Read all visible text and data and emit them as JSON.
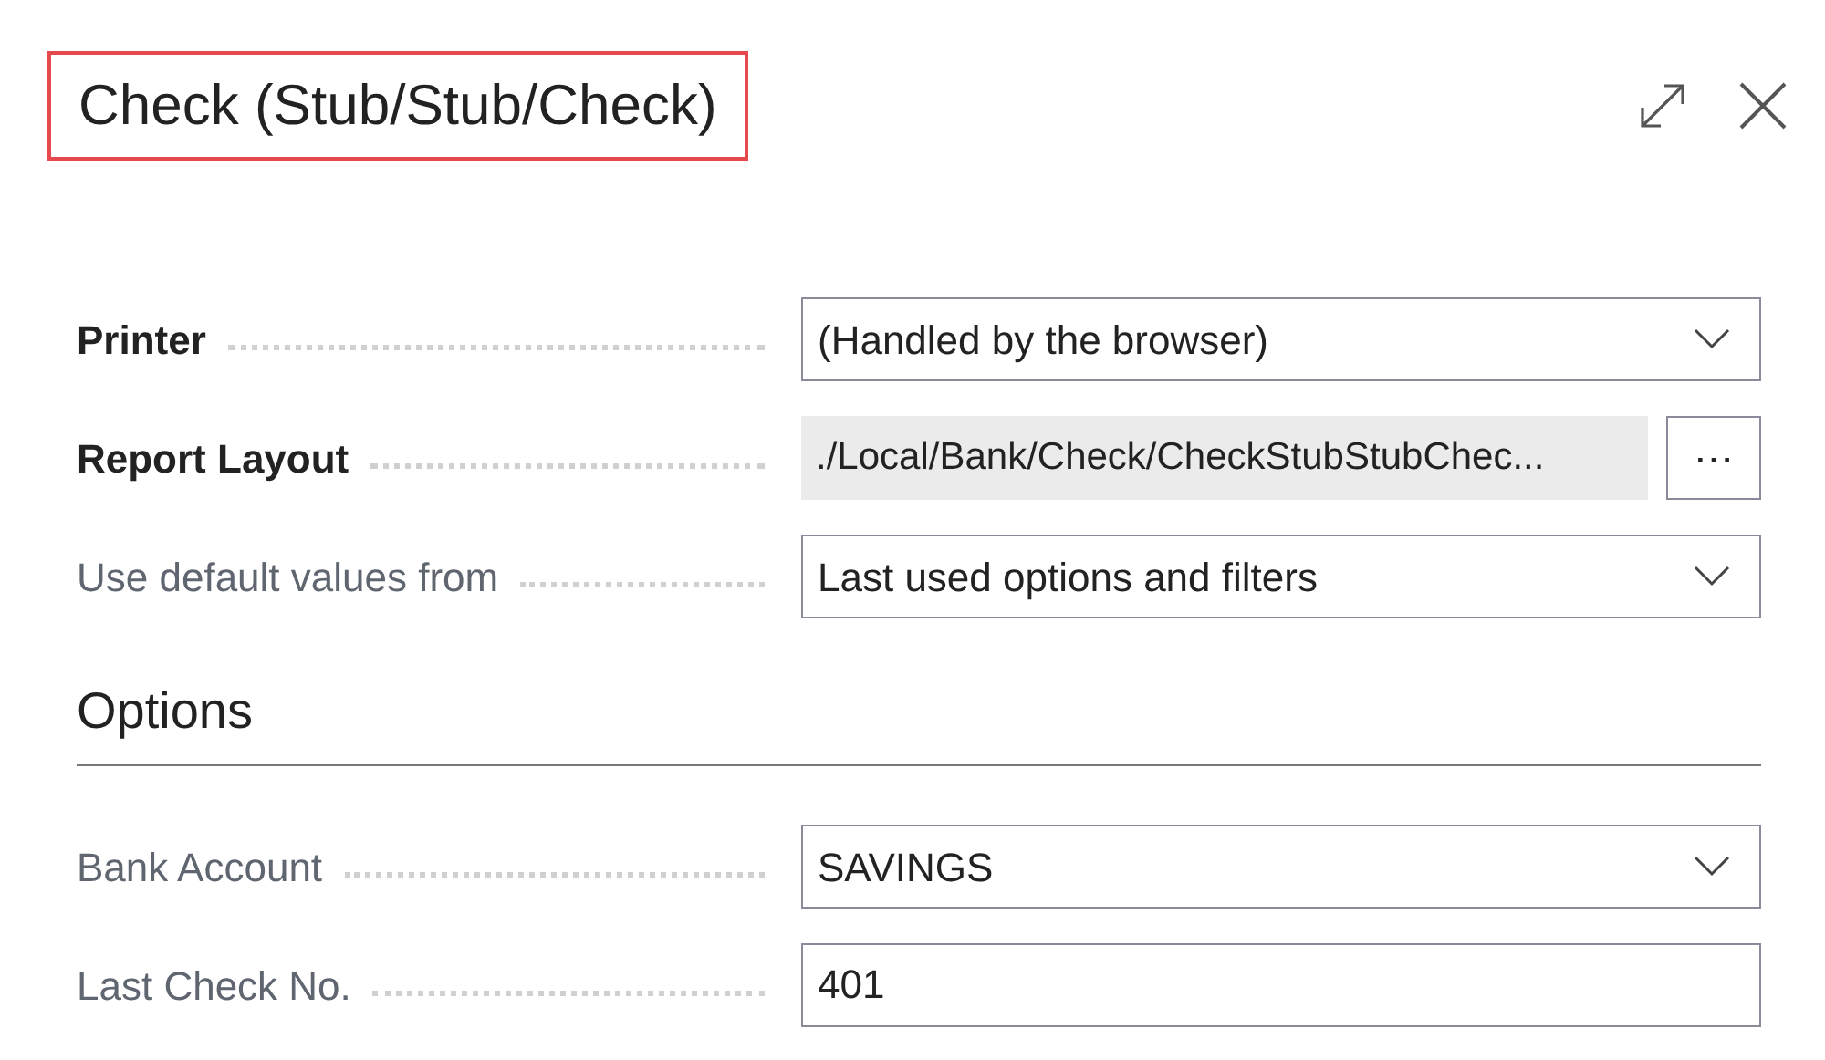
{
  "dialog": {
    "title": "Check (Stub/Stub/Check)",
    "title_highlighted": true
  },
  "fields": [
    {
      "kind": "dropdown",
      "label": "Printer",
      "emphasized": true,
      "value": "(Handled by the browser)"
    },
    {
      "kind": "lookup",
      "label": "Report Layout",
      "emphasized": true,
      "value": "./Local/Bank/Check/CheckStubStubChec...",
      "button": "⋯"
    },
    {
      "kind": "dropdown",
      "label": "Use default values from",
      "emphasized": false,
      "value": "Last used options and filters"
    }
  ],
  "options": {
    "heading": "Options",
    "fields": [
      {
        "kind": "dropdown",
        "label": "Bank Account",
        "emphasized": false,
        "value": "SAVINGS"
      },
      {
        "kind": "text",
        "label": "Last Check No.",
        "emphasized": false,
        "value": "401"
      }
    ]
  }
}
